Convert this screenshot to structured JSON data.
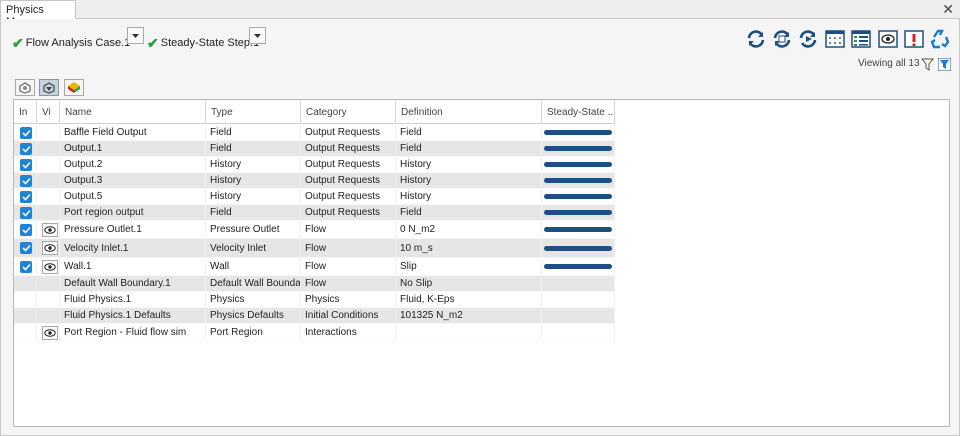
{
  "window": {
    "tab_title": "Physics Manager",
    "close_symbol": "✕"
  },
  "analysis": {
    "case_label": "Flow Analysis Case.1",
    "step_label": "Steady-State Step.1"
  },
  "toolbar": {
    "buttons": [
      "refresh-icon",
      "refresh-all-icon",
      "refresh-run-icon",
      "grid-view-icon",
      "checklist-icon",
      "eye-icon",
      "warning-icon",
      "recycle-icon"
    ]
  },
  "filter": {
    "viewing_text": "Viewing all 13"
  },
  "mode_buttons": [
    "physics-mode-icon",
    "filter-mode-icon",
    "model-mode-icon"
  ],
  "table": {
    "columns": [
      "In",
      "Vi",
      "Name",
      "Type",
      "Category",
      "Definition",
      "Steady-State ..."
    ],
    "rows": [
      {
        "in": true,
        "vi": false,
        "name": "Baffle Field Output",
        "type": "Field",
        "category": "Output Requests",
        "definition": "Field",
        "steady": true
      },
      {
        "in": true,
        "vi": false,
        "name": "Output.1",
        "type": "Field",
        "category": "Output Requests",
        "definition": "Field",
        "steady": true
      },
      {
        "in": true,
        "vi": false,
        "name": "Output.2",
        "type": "History",
        "category": "Output Requests",
        "definition": "History",
        "steady": true
      },
      {
        "in": true,
        "vi": false,
        "name": "Output.3",
        "type": "History",
        "category": "Output Requests",
        "definition": "History",
        "steady": true
      },
      {
        "in": true,
        "vi": false,
        "name": "Output.5",
        "type": "History",
        "category": "Output Requests",
        "definition": "History",
        "steady": true
      },
      {
        "in": true,
        "vi": false,
        "name": "Port region output",
        "type": "Field",
        "category": "Output Requests",
        "definition": "Field",
        "steady": true
      },
      {
        "in": true,
        "vi": true,
        "name": "Pressure Outlet.1",
        "type": "Pressure Outlet",
        "category": "Flow",
        "definition": "0 N_m2",
        "steady": true
      },
      {
        "in": true,
        "vi": true,
        "name": "Velocity Inlet.1",
        "type": "Velocity Inlet",
        "category": "Flow",
        "definition": "10 m_s",
        "steady": true
      },
      {
        "in": true,
        "vi": true,
        "name": "Wall.1",
        "type": "Wall",
        "category": "Flow",
        "definition": "Slip",
        "steady": true
      },
      {
        "in": false,
        "vi": false,
        "name": "Default Wall Boundary.1",
        "type": "Default Wall Boundary",
        "category": "Flow",
        "definition": "No Slip",
        "steady": false
      },
      {
        "in": false,
        "vi": false,
        "name": "Fluid Physics.1",
        "type": "Physics",
        "category": "Physics",
        "definition": "Fluid, K-Eps",
        "steady": false
      },
      {
        "in": false,
        "vi": false,
        "name": "Fluid Physics.1 Defaults",
        "type": "Physics Defaults",
        "category": "Initial Conditions",
        "definition": "101325 N_m2",
        "steady": false
      },
      {
        "in": false,
        "vi": true,
        "name": "Port Region - Fluid flow sim",
        "type": "Port Region",
        "category": "Interactions",
        "definition": "",
        "steady": false
      }
    ]
  },
  "colors": {
    "check_green": "#2e9b3a",
    "checkbox_blue": "#1f84d6",
    "bar_navy": "#1d4f82",
    "alt_row": "#e6e6e6"
  }
}
